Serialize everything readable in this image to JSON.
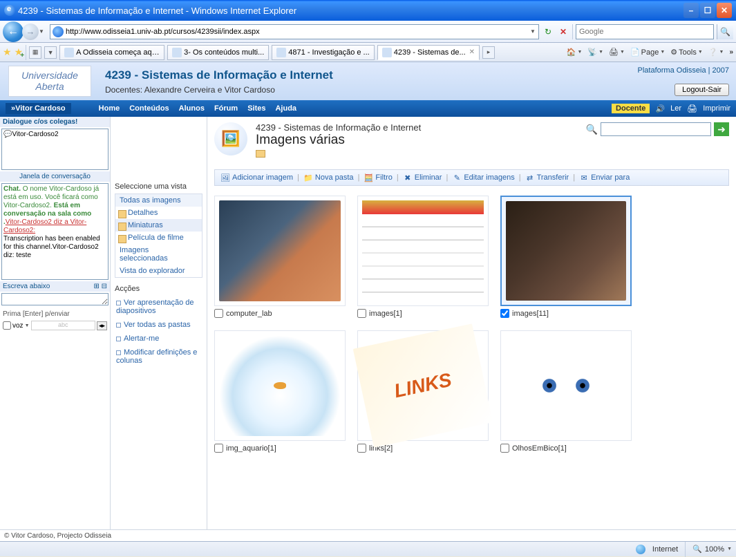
{
  "window": {
    "title": "4239 - Sistemas de Informação e Internet - Windows Internet Explorer"
  },
  "address": {
    "url": "http://www.odisseia1.univ-ab.pt/cursos/4239sii/index.aspx"
  },
  "search": {
    "placeholder": "Google"
  },
  "browser_tabs": [
    {
      "label": "A Odisseia começa aqui!"
    },
    {
      "label": "3- Os conteúdos multi..."
    },
    {
      "label": "4871 - Investigação e ..."
    },
    {
      "label": "4239 - Sistemas de...",
      "active": true
    }
  ],
  "ie_tools": {
    "page": "Page",
    "tools": "Tools"
  },
  "header": {
    "platform": "Plataforma Odisseia | 2007",
    "title": "4239 - Sistemas de Informação e Internet",
    "subtitle": "Docentes: Alexandre Cerveira e Vitor Cardoso",
    "logout": "Logout-Sair",
    "logo_l1": "Universidade",
    "logo_l2": "Aberta"
  },
  "nav": {
    "user": "»Vitor Cardoso",
    "items": [
      "Home",
      "Conteúdos",
      "Alunos",
      "Fórum",
      "Sites",
      "Ajuda"
    ],
    "badge": "Docente",
    "ler": "Ler",
    "imprimir": "Imprimir"
  },
  "chat": {
    "header": "Dialogue c/os colegas!",
    "user": "Vitor-Cardoso2",
    "panel_label": "Janela de conversação",
    "msg_prefix": "Chat.",
    "msg_1": " O nome Vitor-Cardoso já está em uso. Você ficará como Vitor-Cardoso2. ",
    "msg_bold": "Está em conversação na sala como .",
    "msg_link": "Vitor-Cardoso2 diz a Vitor-Cardoso2:",
    "msg_tail": "Transcription has been enabled for this channel.Vitor-Cardoso2 diz: teste",
    "input_label": "Escreva abaixo",
    "send_hint": "Prima [Enter] p/enviar",
    "voz": "voz",
    "voz_ph": "abc"
  },
  "views": {
    "select_label": "Seleccione uma vista",
    "all_images": "Todas as imagens",
    "detalhes": "Detalhes",
    "miniaturas": "Miniaturas",
    "pelicula": "Película de filme",
    "selected": "Imagens seleccionadas",
    "explorer": "Vista do explorador",
    "actions_label": "Acções",
    "a1": "Ver apresentação de diapositivos",
    "a2": "Ver todas as pastas",
    "a3": "Alertar-me",
    "a4": "Modificar definições e colunas"
  },
  "main": {
    "breadcrumb": "4239 - Sistemas de Informação e Internet",
    "title": "Imagens várias"
  },
  "toolbar": {
    "add": "Adicionar imagem",
    "folder": "Nova pasta",
    "filter": "Filtro",
    "delete": "Eliminar",
    "edit": "Editar imagens",
    "transfer": "Transferir",
    "send": "Enviar para"
  },
  "items": [
    {
      "label": "computer_lab",
      "checked": false,
      "selected": false,
      "ph": "ph-lab"
    },
    {
      "label": "images[1]",
      "checked": false,
      "selected": false,
      "ph": "ph-cal"
    },
    {
      "label": "images[11]",
      "checked": true,
      "selected": true,
      "ph": "ph-aud"
    },
    {
      "label": "img_aquario[1]",
      "checked": false,
      "selected": false,
      "ph": "ph-fish"
    },
    {
      "label": "links[2]",
      "checked": false,
      "selected": false,
      "ph": "ph-links"
    },
    {
      "label": "OlhosEmBico[1]",
      "checked": false,
      "selected": false,
      "ph": "ph-olhos"
    }
  ],
  "status": {
    "app": "© Vitor Cardoso, Projecto Odisseia",
    "zone": "Internet",
    "zoom": "100%"
  }
}
